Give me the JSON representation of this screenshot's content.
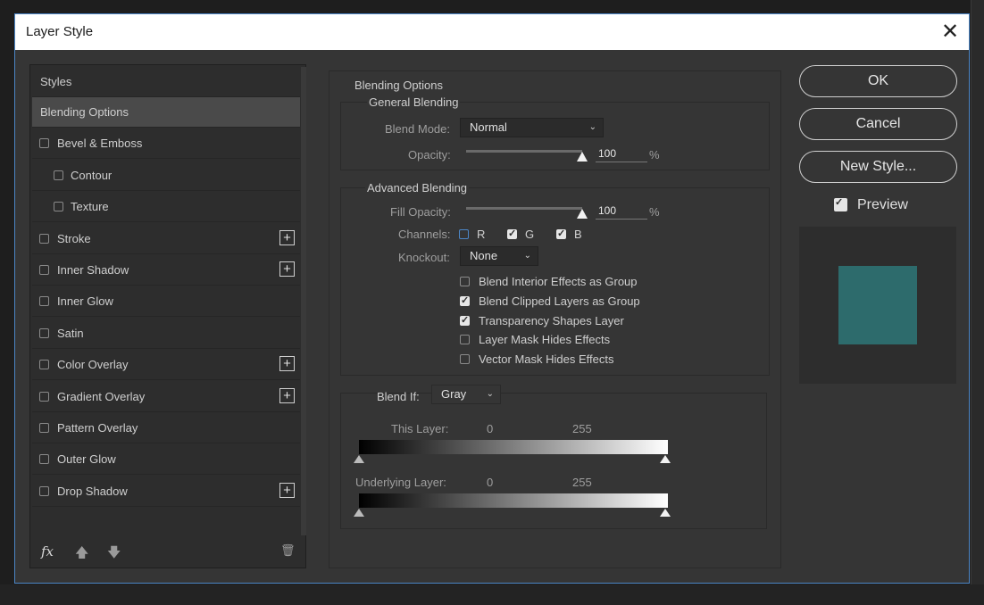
{
  "dialog": {
    "title": "Layer Style",
    "close_glyph": "✕"
  },
  "styles": {
    "header": "Styles",
    "items": [
      {
        "label": "Blending Options",
        "checkbox": false,
        "checked": false,
        "plus": false,
        "selected": true,
        "indent": false
      },
      {
        "label": "Bevel & Emboss",
        "checkbox": true,
        "checked": false,
        "plus": false,
        "indent": false
      },
      {
        "label": "Contour",
        "checkbox": true,
        "checked": false,
        "plus": false,
        "indent": true
      },
      {
        "label": "Texture",
        "checkbox": true,
        "checked": false,
        "plus": false,
        "indent": true
      },
      {
        "label": "Stroke",
        "checkbox": true,
        "checked": false,
        "plus": true,
        "indent": false
      },
      {
        "label": "Inner Shadow",
        "checkbox": true,
        "checked": false,
        "plus": true,
        "indent": false
      },
      {
        "label": "Inner Glow",
        "checkbox": true,
        "checked": false,
        "plus": false,
        "indent": false
      },
      {
        "label": "Satin",
        "checkbox": true,
        "checked": false,
        "plus": false,
        "indent": false
      },
      {
        "label": "Color Overlay",
        "checkbox": true,
        "checked": false,
        "plus": true,
        "indent": false
      },
      {
        "label": "Gradient Overlay",
        "checkbox": true,
        "checked": false,
        "plus": true,
        "indent": false
      },
      {
        "label": "Pattern Overlay",
        "checkbox": true,
        "checked": false,
        "plus": false,
        "indent": false
      },
      {
        "label": "Outer Glow",
        "checkbox": true,
        "checked": false,
        "plus": false,
        "indent": false
      },
      {
        "label": "Drop Shadow",
        "checkbox": true,
        "checked": false,
        "plus": true,
        "indent": false
      }
    ],
    "toolbar": {
      "fx": "fx",
      "up": "🡅",
      "down": "🡇",
      "trash": "🗑"
    },
    "plus_glyph": "+"
  },
  "blending": {
    "section_title": "Blending Options",
    "general": {
      "title": "General Blending",
      "blend_mode_label": "Blend Mode:",
      "blend_mode_value": "Normal",
      "opacity_label": "Opacity:",
      "opacity_value": "100",
      "percent": "%"
    },
    "advanced": {
      "title": "Advanced Blending",
      "fill_opacity_label": "Fill Opacity:",
      "fill_opacity_value": "100",
      "percent": "%",
      "channels_label": "Channels:",
      "channels": [
        {
          "label": "R",
          "checked": false
        },
        {
          "label": "G",
          "checked": true
        },
        {
          "label": "B",
          "checked": true
        }
      ],
      "knockout_label": "Knockout:",
      "knockout_value": "None",
      "options": [
        {
          "label": "Blend Interior Effects as Group",
          "checked": false
        },
        {
          "label": "Blend Clipped Layers as Group",
          "checked": true
        },
        {
          "label": "Transparency Shapes Layer",
          "checked": true
        },
        {
          "label": "Layer Mask Hides Effects",
          "checked": false
        },
        {
          "label": "Vector Mask Hides Effects",
          "checked": false
        }
      ]
    },
    "blend_if": {
      "label": "Blend If:",
      "value": "Gray",
      "this_layer_label": "This Layer:",
      "this_layer_min": "0",
      "this_layer_max": "255",
      "underlying_label": "Underlying Layer:",
      "underlying_min": "0",
      "underlying_max": "255"
    }
  },
  "actions": {
    "ok": "OK",
    "cancel": "Cancel",
    "new_style": "New Style...",
    "preview_label": "Preview",
    "preview_checked": true,
    "preview_color": "#2d6b6c"
  }
}
